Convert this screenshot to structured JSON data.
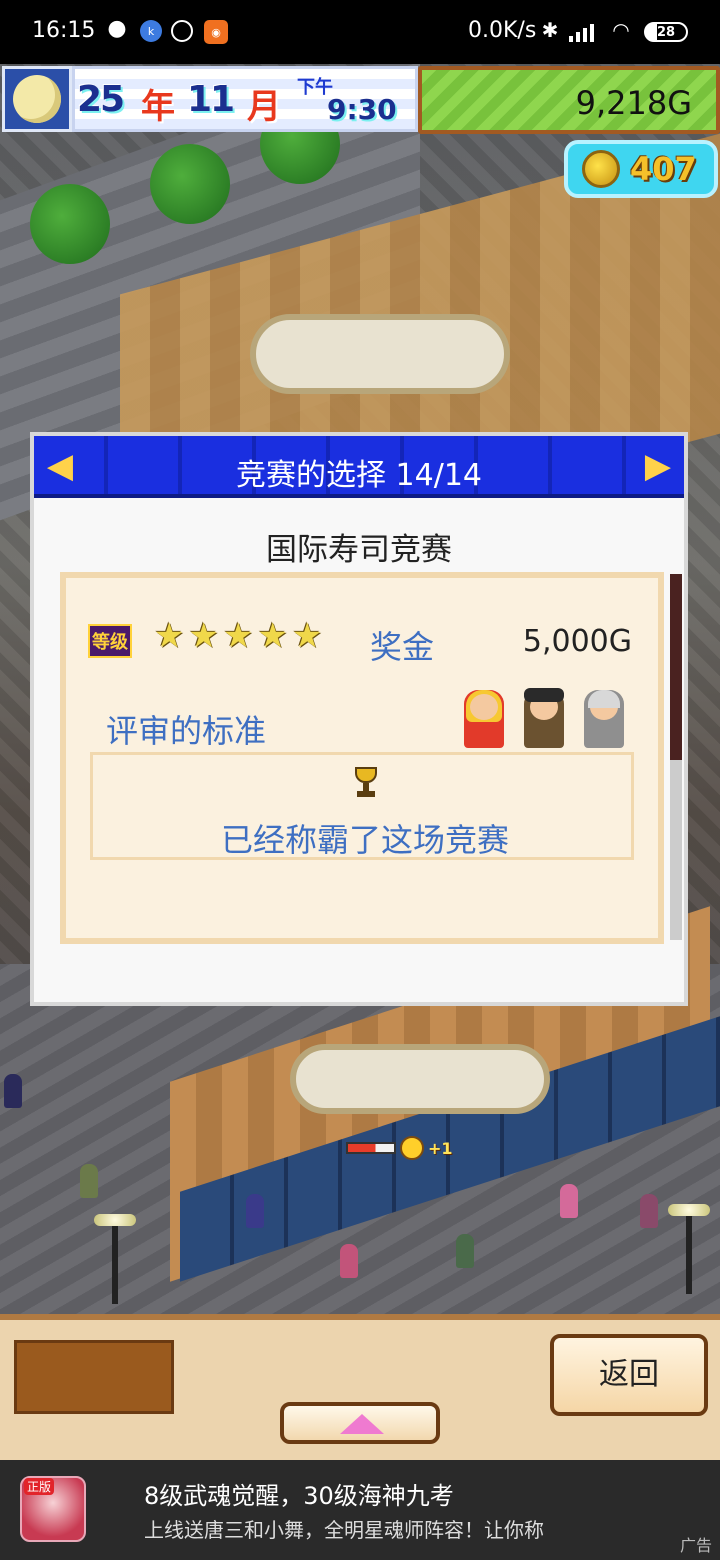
{
  "status_bar": {
    "time": "16:15",
    "network_speed": "0.0K/s",
    "battery": "28",
    "icons": [
      "wechat-icon",
      "app-icon",
      "stopwatch-icon",
      "app-icon",
      "bluetooth-icon",
      "signal-icon",
      "wifi-icon",
      "battery-icon"
    ]
  },
  "hud": {
    "year": "25",
    "year_unit": "年",
    "month": "11",
    "month_unit": "月",
    "ampm": "下午",
    "clock": "9:30",
    "money": "9,218G",
    "coins": "407"
  },
  "dialog": {
    "title": "竞赛的选择 14/14",
    "contest_name": "国际寿司竞赛",
    "rank_label": "等级",
    "stars": 5,
    "prize_label": "奖金",
    "prize_value": "5,000G",
    "judge_label": "评审的标准",
    "result_text": "已经称霸了这场竞赛"
  },
  "scene": {
    "mood_bonus": "+1"
  },
  "bottom": {
    "back_label": "返回"
  },
  "ad": {
    "icon_tag": "正版",
    "title": "8级武魂觉醒，30级海神九考",
    "subtitle": "上线送唐三和小舞，全明星魂师阵容！让你称",
    "tag": "广告"
  },
  "colors": {
    "dialog_header": "#1a2fe0",
    "accent_text": "#3e6fc2",
    "money_bg": "#8fd64e",
    "coin_bg": "#3fd6f0"
  }
}
